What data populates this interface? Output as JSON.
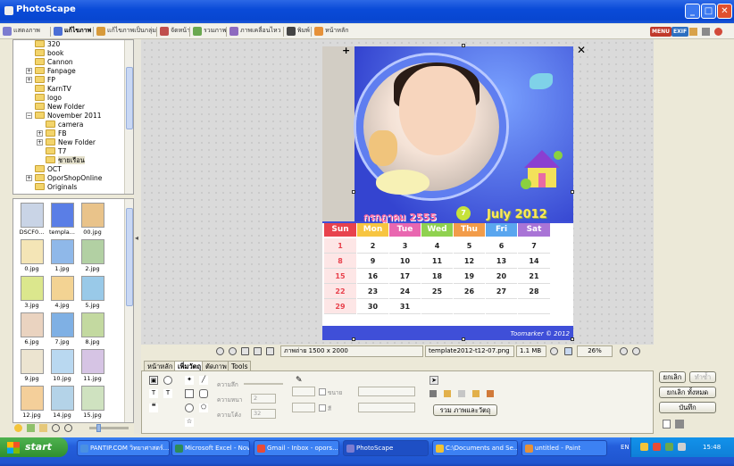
{
  "window": {
    "title": "PhotoScape",
    "buttons": [
      "_",
      "□",
      "✕"
    ]
  },
  "toolbar": {
    "tabs": [
      {
        "label": "แสดงภาพ",
        "color": "#7c7cd0"
      },
      {
        "label": "แก้ไขภาพ",
        "color": "#4b6fd6",
        "active": true
      },
      {
        "label": "แก้ไขภาพเป็นกลุ่ม",
        "color": "#d79a3a"
      },
      {
        "label": "จัดหน้า",
        "color": "#c0504d"
      },
      {
        "label": "รวมภาพ",
        "color": "#6aa84f"
      },
      {
        "label": "ภาพเคลื่อนไหว",
        "color": "#8e6bbf"
      },
      {
        "label": "พิมพ์",
        "color": "#444444"
      },
      {
        "label": "หน้าหลัก",
        "color": "#e69138"
      }
    ],
    "right_badges": [
      "MENU",
      "EXIF"
    ]
  },
  "tree": {
    "items": [
      {
        "label": "320",
        "level": 2
      },
      {
        "label": "book",
        "level": 2
      },
      {
        "label": "Cannon",
        "level": 2
      },
      {
        "label": "Fanpage",
        "level": 2,
        "expander": "+"
      },
      {
        "label": "FP",
        "level": 2,
        "expander": "+"
      },
      {
        "label": "KarnTV",
        "level": 2
      },
      {
        "label": "logo",
        "level": 2
      },
      {
        "label": "New Folder",
        "level": 2
      },
      {
        "label": "November 2011",
        "level": 2,
        "expander": "−"
      },
      {
        "label": "camera",
        "level": 3
      },
      {
        "label": "FB",
        "level": 3,
        "expander": "+"
      },
      {
        "label": "New Folder",
        "level": 3,
        "expander": "+"
      },
      {
        "label": "T7",
        "level": 3
      },
      {
        "label": "ชายเรือน",
        "level": 3,
        "selected": true
      },
      {
        "label": "OCT",
        "level": 2
      },
      {
        "label": "OporShopOnline",
        "level": 2,
        "expander": "+"
      },
      {
        "label": "Originals",
        "level": 2
      }
    ]
  },
  "thumbnails": [
    {
      "label": "DSCF0...",
      "color": "#c9d4e6"
    },
    {
      "label": "templa...",
      "color": "#5a7ee6"
    },
    {
      "label": "00.jpg",
      "color": "#e9c38a"
    },
    {
      "label": "0.jpg",
      "color": "#f4e5b6"
    },
    {
      "label": "1.jpg",
      "color": "#8fb8e9"
    },
    {
      "label": "2.jpg",
      "color": "#b2d0a3"
    },
    {
      "label": "3.jpg",
      "color": "#dbe78d"
    },
    {
      "label": "4.jpg",
      "color": "#f3d393"
    },
    {
      "label": "5.jpg",
      "color": "#99c9e8"
    },
    {
      "label": "6.jpg",
      "color": "#ead3c0"
    },
    {
      "label": "7.jpg",
      "color": "#7fb0e4"
    },
    {
      "label": "8.jpg",
      "color": "#c3d9a0"
    },
    {
      "label": "9.jpg",
      "color": "#ece4d0"
    },
    {
      "label": "10.jpg",
      "color": "#b9d8f0"
    },
    {
      "label": "11.jpg",
      "color": "#d6c4e4"
    },
    {
      "label": "12.jpg",
      "color": "#f4cf9a"
    },
    {
      "label": "14.jpg",
      "color": "#b4d3e8"
    },
    {
      "label": "15.jpg",
      "color": "#cfe2c0"
    }
  ],
  "calendar": {
    "month_th": "กรกฎาคม 2555",
    "month_num": "7",
    "month_en": "July 2012",
    "days": [
      {
        "label": "Sun",
        "color": "#e8424d"
      },
      {
        "label": "Mon",
        "color": "#f7c541"
      },
      {
        "label": "Tue",
        "color": "#e967b0"
      },
      {
        "label": "Wed",
        "color": "#8fd14f"
      },
      {
        "label": "Thu",
        "color": "#f29c4a"
      },
      {
        "label": "Fri",
        "color": "#5aa6ef"
      },
      {
        "label": "Sat",
        "color": "#a974d6"
      }
    ],
    "weeks": [
      [
        "1",
        "2",
        "3",
        "4",
        "5",
        "6",
        "7"
      ],
      [
        "8",
        "9",
        "10",
        "11",
        "12",
        "13",
        "14"
      ],
      [
        "15",
        "16",
        "17",
        "18",
        "19",
        "20",
        "21"
      ],
      [
        "22",
        "23",
        "24",
        "25",
        "26",
        "27",
        "28"
      ],
      [
        "29",
        "30",
        "31",
        "",
        "",
        "",
        ""
      ]
    ],
    "credit": "Toomarker © 2012"
  },
  "status": {
    "size": "ภาพถ่าย 1500 x 2000",
    "filename": "template2012-t12-07.png",
    "filesize": "1.1 MB",
    "zoom": "26%"
  },
  "edit_tabs": [
    "หน้าหลัก",
    "เพิ่มวัตถุ",
    "ตัดภาพ",
    "Tools"
  ],
  "edit": {
    "line_label": "ความลึก",
    "width_label": "ความหนา",
    "width_value": "2",
    "round_label": "ความโค้ง",
    "round_value": "32",
    "shadow_label": "ขนาย",
    "color_label": "สี",
    "group_button": "รวม ภาพและวัตถุ"
  },
  "right": {
    "cancel": "ยกเลิก",
    "redo": "ทำซ้ำ",
    "cancel_all": "ยกเลิก ทั้งหมด",
    "save": "บันทึก"
  },
  "taskbar": {
    "start": "start",
    "tasks": [
      {
        "label": "PANTIP.COM วิทยาศาสตร์...",
        "color": "#4a90e2"
      },
      {
        "label": "Microsoft Excel - Nov...",
        "color": "#2e8b57"
      },
      {
        "label": "Gmail - Inbox - opors...",
        "color": "#e94b35"
      },
      {
        "label": "PhotoScape",
        "color": "#7c7cd0",
        "active": true
      },
      {
        "label": "C:\\Documents and Se...",
        "color": "#f1c232"
      },
      {
        "label": "untitled - Paint",
        "color": "#e69138"
      }
    ],
    "lang": "EN",
    "time": "15:48"
  }
}
